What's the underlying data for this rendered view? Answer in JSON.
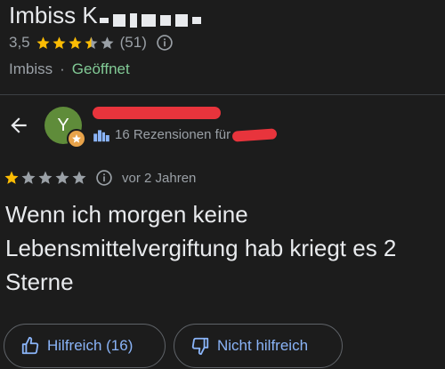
{
  "place": {
    "title_visible": "Imbiss K",
    "rating": "3,5",
    "stars_filled": 3.5,
    "review_count": "(51)",
    "category": "Imbiss",
    "separator": "·",
    "status": "Geöffnet"
  },
  "review": {
    "author_initial": "Y",
    "author_reviews": "16 Rezensionen für",
    "stars": 1,
    "time_ago": "vor 2 Jahren",
    "text": "Wenn ich morgen keine Lebensmittelvergiftung hab kriegt es 2 Sterne"
  },
  "actions": {
    "helpful_label": "Hilfreich (16)",
    "not_helpful_label": "Nicht hilfreich"
  },
  "colors": {
    "background": "#1c1c1c",
    "star_gold": "#fbbc04",
    "star_grey": "#9aa0a6",
    "accent_blue": "#8ab4f8",
    "open_green": "#81c995",
    "avatar_green": "#5f8c3a",
    "redaction_red": "#e8343c"
  },
  "icons": [
    "star-icon",
    "info-icon",
    "back-arrow-icon",
    "local-guide-badge-icon",
    "city-icon",
    "thumbs-up-icon",
    "thumbs-down-icon"
  ]
}
